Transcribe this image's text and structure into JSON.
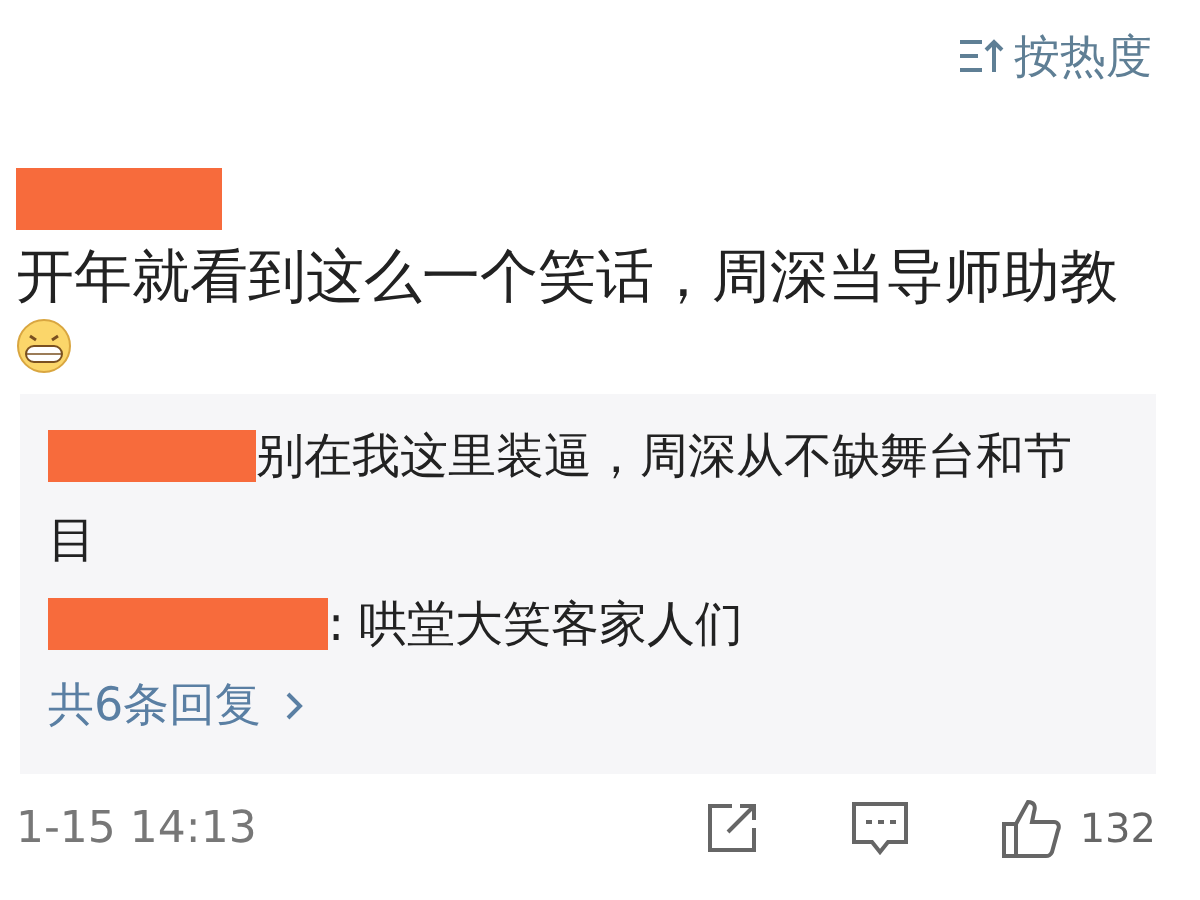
{
  "sort_control": {
    "label": "按热度"
  },
  "comment": {
    "text": "开年就看到这么一个笑话，周深当导师助教",
    "replies": [
      {
        "text": "别在我这里装逼，周深从不缺舞台和节目"
      },
      {
        "text": "哄堂大笑客家人们",
        "separator": ":"
      }
    ],
    "more_replies": "共6条回复",
    "time": "1-15 14:13",
    "likes": "132"
  }
}
